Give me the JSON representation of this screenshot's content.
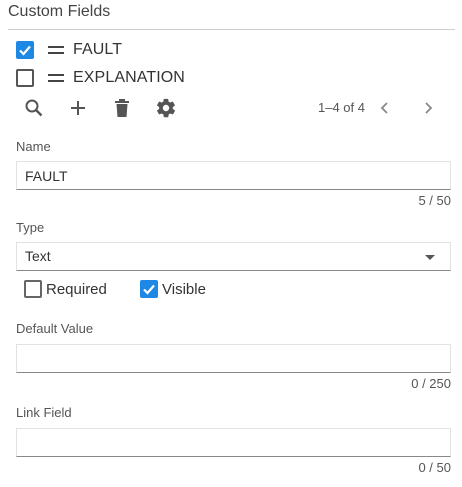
{
  "panel": {
    "title": "Custom Fields"
  },
  "field_list": [
    {
      "label": "FAULT",
      "checked": true
    },
    {
      "label": "EXPLANATION",
      "checked": false
    }
  ],
  "toolbar": {
    "icons": [
      "search-icon",
      "add-icon",
      "delete-icon",
      "settings-icon"
    ],
    "pagination": "1–4 of 4"
  },
  "form": {
    "name": {
      "label": "Name",
      "value": "FAULT",
      "counter": "5 / 50"
    },
    "type": {
      "label": "Type",
      "value": "Text"
    },
    "required": {
      "label": "Required",
      "checked": false
    },
    "visible": {
      "label": "Visible",
      "checked": true
    },
    "default_value": {
      "label": "Default Value",
      "value": "",
      "counter": "0 / 250"
    },
    "link_field": {
      "label": "Link Field",
      "value": "",
      "counter": "0 / 50"
    }
  },
  "colors": {
    "accent": "#1e88e5",
    "text": "#333333",
    "rule": "#cfcfcf"
  }
}
